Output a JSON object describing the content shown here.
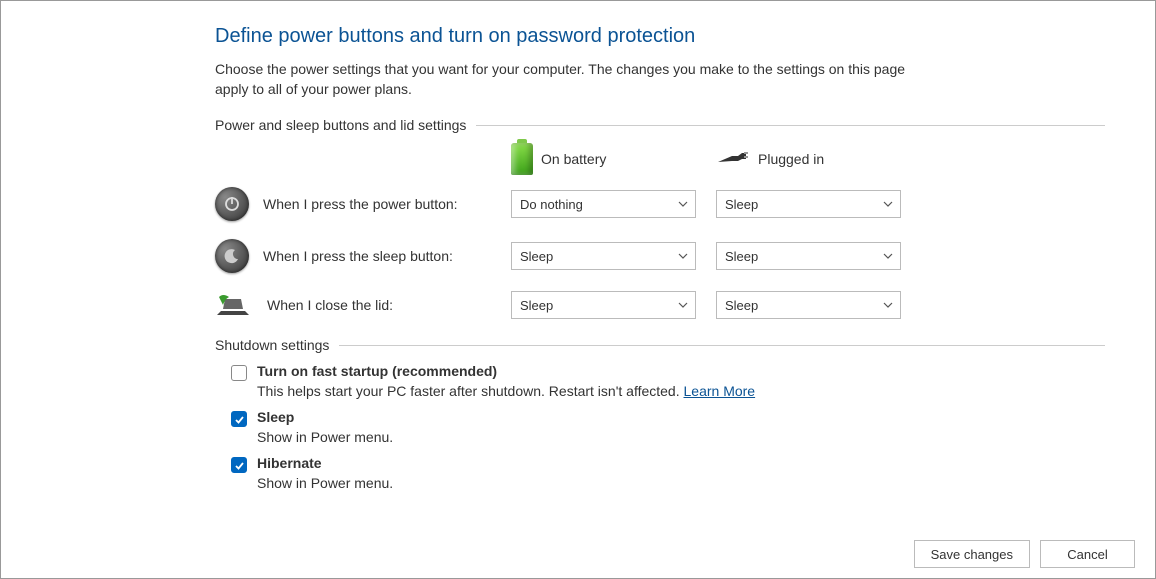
{
  "title": "Define power buttons and turn on password protection",
  "subtitle": "Choose the power settings that you want for your computer. The changes you make to the settings on this page apply to all of your power plans.",
  "section1_label": "Power and sleep buttons and lid settings",
  "col_battery": "On battery",
  "col_plugged": "Plugged in",
  "rows": {
    "power": {
      "label": "When I press the power button:",
      "battery": "Do nothing",
      "plugged": "Sleep"
    },
    "sleep": {
      "label": "When I press the sleep button:",
      "battery": "Sleep",
      "plugged": "Sleep"
    },
    "lid": {
      "label": "When I close the lid:",
      "battery": "Sleep",
      "plugged": "Sleep"
    }
  },
  "section2_label": "Shutdown settings",
  "shutdown": {
    "fast": {
      "label": "Turn on fast startup (recommended)",
      "desc": "This helps start your PC faster after shutdown. Restart isn't affected. ",
      "link": "Learn More",
      "checked": false
    },
    "sleep": {
      "label": "Sleep",
      "desc": "Show in Power menu.",
      "checked": true
    },
    "hibernate": {
      "label": "Hibernate",
      "desc": "Show in Power menu.",
      "checked": true
    }
  },
  "buttons": {
    "save": "Save changes",
    "cancel": "Cancel"
  }
}
